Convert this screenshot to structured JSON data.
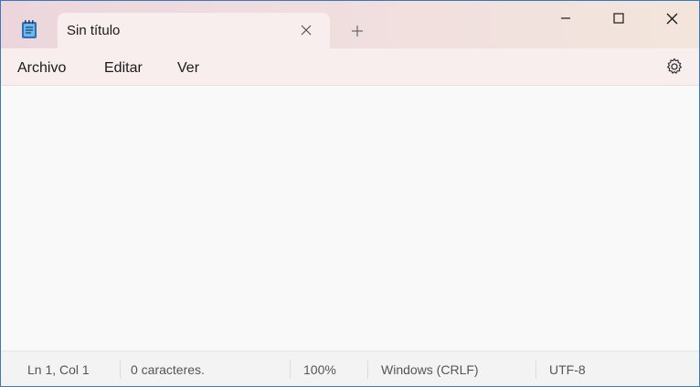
{
  "tab": {
    "title": "Sin título"
  },
  "menu": {
    "file": "Archivo",
    "edit": "Editar",
    "view": "Ver"
  },
  "status": {
    "position": "Ln 1, Col 1",
    "characters": "0 caracteres.",
    "zoom": "100%",
    "line_endings": "Windows (CRLF)",
    "encoding": "UTF-8"
  },
  "editor": {
    "content": ""
  },
  "colors": {
    "accent_border": "#3a7ab8",
    "titlebar": "#ecd6dc",
    "tab_bg": "#f8eeee"
  },
  "icons": [
    "notepad-app-icon",
    "close-tab-icon",
    "plus-icon",
    "minimize-icon",
    "maximize-icon",
    "close-icon",
    "gear-icon"
  ]
}
